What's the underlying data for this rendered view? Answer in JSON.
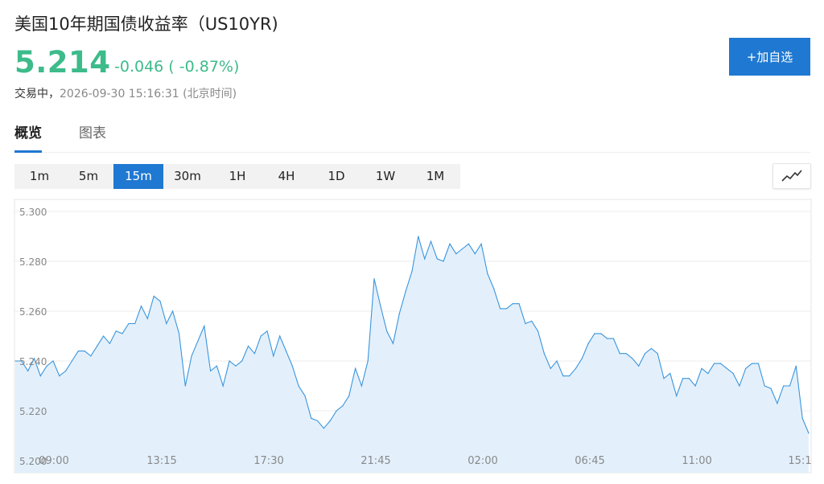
{
  "header": {
    "title": "美国10年期国债收益率（US10YR)",
    "price": "5.214",
    "change": "-0.046 ( -0.87%)",
    "status_prefix": "交易中，",
    "timestamp": "2026-09-30 15:16:31 (北京时间)",
    "add_button": "+加自选"
  },
  "tabs": [
    {
      "label": "概览",
      "active": true
    },
    {
      "label": "图表",
      "active": false
    }
  ],
  "intervals": [
    {
      "label": "1m",
      "active": false
    },
    {
      "label": "5m",
      "active": false
    },
    {
      "label": "15m",
      "active": true
    },
    {
      "label": "30m",
      "active": false
    },
    {
      "label": "1H",
      "active": false
    },
    {
      "label": "4H",
      "active": false
    },
    {
      "label": "1D",
      "active": false
    },
    {
      "label": "1W",
      "active": false
    },
    {
      "label": "1M",
      "active": false
    }
  ],
  "chart_toggle_icon": "line-chart-icon",
  "colors": {
    "accent": "#1f78d1",
    "up_green": "#3dbb8b",
    "line": "#3a95dd",
    "area": "#e3f0fc"
  },
  "chart_data": {
    "type": "area",
    "title": "",
    "xlabel": "",
    "ylabel": "",
    "ylim": [
      5.2,
      5.3
    ],
    "y_ticks": [
      "5.300",
      "5.280",
      "5.260",
      "5.240",
      "5.220",
      "5.200"
    ],
    "x_ticks": [
      "09:00",
      "13:15",
      "17:30",
      "21:45",
      "02:00",
      "06:45",
      "11:00",
      "15:1"
    ],
    "grid": true,
    "series": [
      {
        "values": [
          5.24,
          5.24,
          5.236,
          5.241,
          5.234,
          5.238,
          5.24,
          5.234,
          5.236,
          5.24,
          5.244,
          5.244,
          5.242,
          5.246,
          5.25,
          5.247,
          5.252,
          5.251,
          5.255,
          5.255,
          5.262,
          5.257,
          5.266,
          5.264,
          5.255,
          5.26,
          5.251,
          5.23,
          5.242,
          5.248,
          5.254,
          5.236,
          5.238,
          5.23,
          5.24,
          5.238,
          5.24,
          5.246,
          5.243,
          5.25,
          5.252,
          5.242,
          5.25,
          5.244,
          5.238,
          5.23,
          5.226,
          5.217,
          5.216,
          5.213,
          5.216,
          5.22,
          5.222,
          5.226,
          5.237,
          5.23,
          5.24,
          5.273,
          5.262,
          5.252,
          5.247,
          5.259,
          5.268,
          5.276,
          5.29,
          5.281,
          5.288,
          5.281,
          5.28,
          5.287,
          5.283,
          5.285,
          5.287,
          5.283,
          5.287,
          5.275,
          5.269,
          5.261,
          5.261,
          5.263,
          5.263,
          5.255,
          5.256,
          5.252,
          5.243,
          5.237,
          5.24,
          5.234,
          5.234,
          5.237,
          5.241,
          5.247,
          5.251,
          5.251,
          5.249,
          5.249,
          5.243,
          5.243,
          5.241,
          5.238,
          5.243,
          5.245,
          5.243,
          5.233,
          5.235,
          5.226,
          5.233,
          5.233,
          5.23,
          5.237,
          5.235,
          5.239,
          5.239,
          5.237,
          5.235,
          5.23,
          5.237,
          5.239,
          5.239,
          5.23,
          5.229,
          5.223,
          5.23,
          5.23,
          5.238,
          5.217,
          5.211
        ]
      }
    ]
  }
}
